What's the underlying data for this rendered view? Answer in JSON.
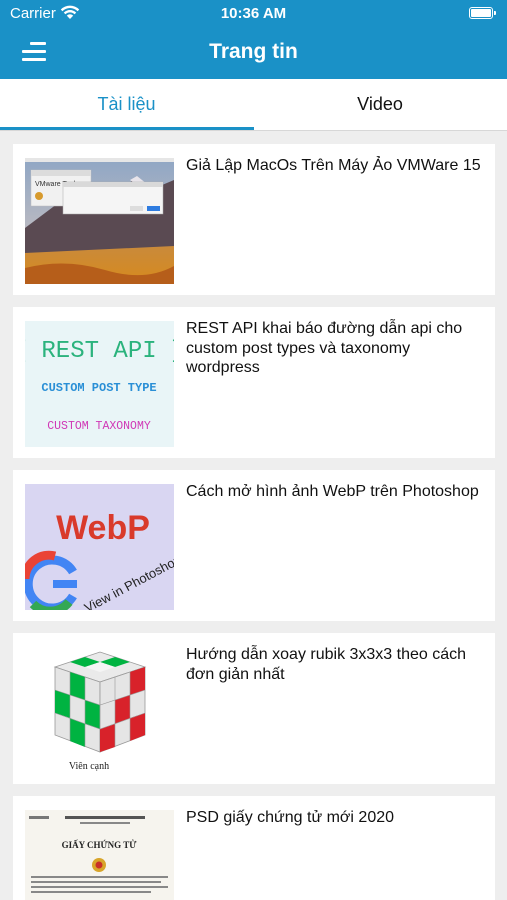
{
  "status_bar": {
    "carrier": "Carrier",
    "time": "10:36 AM"
  },
  "nav": {
    "title": "Trang tin"
  },
  "tabs": [
    {
      "label": "Tài liệu",
      "active": true
    },
    {
      "label": "Video",
      "active": false
    }
  ],
  "colors": {
    "accent": "#1a91c7",
    "background": "#eeeeee"
  },
  "articles": [
    {
      "title": "Giả Lập MacOs Trên Máy Ảo VMWare 15",
      "thumb_text": "VMware Tools"
    },
    {
      "title": "REST API khai báo đường dẫn api cho custom post types và taxonomy wordpress",
      "thumb_lines": [
        "{ REST API }",
        "CUSTOM POST TYPE",
        "CUSTOM TAXONOMY"
      ]
    },
    {
      "title": "Cách mở hình ảnh WebP trên Photoshop",
      "thumb_lines": [
        "WebP",
        "View in Photoshop"
      ]
    },
    {
      "title": "Hướng dẫn xoay rubik 3x3x3 theo cách đơn giản nhất",
      "thumb_caption": "Viên cạnh"
    },
    {
      "title": "PSD giấy chứng tử mới 2020",
      "thumb_lines": [
        "GIẤY CHỨNG TỬ"
      ]
    }
  ]
}
